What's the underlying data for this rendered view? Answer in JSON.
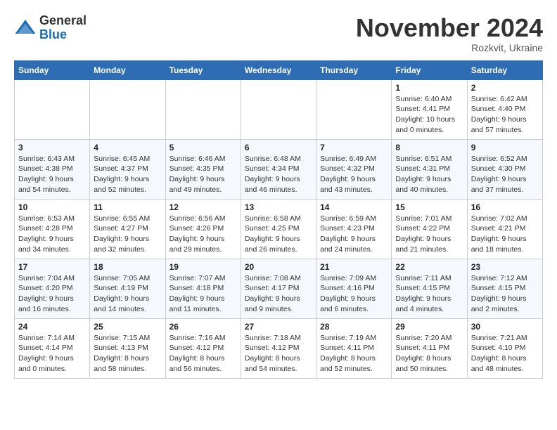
{
  "header": {
    "logo_line1": "General",
    "logo_line2": "Blue",
    "month": "November 2024",
    "location": "Rozkvit, Ukraine"
  },
  "weekdays": [
    "Sunday",
    "Monday",
    "Tuesday",
    "Wednesday",
    "Thursday",
    "Friday",
    "Saturday"
  ],
  "weeks": [
    [
      {
        "day": "",
        "info": ""
      },
      {
        "day": "",
        "info": ""
      },
      {
        "day": "",
        "info": ""
      },
      {
        "day": "",
        "info": ""
      },
      {
        "day": "",
        "info": ""
      },
      {
        "day": "1",
        "info": "Sunrise: 6:40 AM\nSunset: 4:41 PM\nDaylight: 10 hours\nand 0 minutes."
      },
      {
        "day": "2",
        "info": "Sunrise: 6:42 AM\nSunset: 4:40 PM\nDaylight: 9 hours\nand 57 minutes."
      }
    ],
    [
      {
        "day": "3",
        "info": "Sunrise: 6:43 AM\nSunset: 4:38 PM\nDaylight: 9 hours\nand 54 minutes."
      },
      {
        "day": "4",
        "info": "Sunrise: 6:45 AM\nSunset: 4:37 PM\nDaylight: 9 hours\nand 52 minutes."
      },
      {
        "day": "5",
        "info": "Sunrise: 6:46 AM\nSunset: 4:35 PM\nDaylight: 9 hours\nand 49 minutes."
      },
      {
        "day": "6",
        "info": "Sunrise: 6:48 AM\nSunset: 4:34 PM\nDaylight: 9 hours\nand 46 minutes."
      },
      {
        "day": "7",
        "info": "Sunrise: 6:49 AM\nSunset: 4:32 PM\nDaylight: 9 hours\nand 43 minutes."
      },
      {
        "day": "8",
        "info": "Sunrise: 6:51 AM\nSunset: 4:31 PM\nDaylight: 9 hours\nand 40 minutes."
      },
      {
        "day": "9",
        "info": "Sunrise: 6:52 AM\nSunset: 4:30 PM\nDaylight: 9 hours\nand 37 minutes."
      }
    ],
    [
      {
        "day": "10",
        "info": "Sunrise: 6:53 AM\nSunset: 4:28 PM\nDaylight: 9 hours\nand 34 minutes."
      },
      {
        "day": "11",
        "info": "Sunrise: 6:55 AM\nSunset: 4:27 PM\nDaylight: 9 hours\nand 32 minutes."
      },
      {
        "day": "12",
        "info": "Sunrise: 6:56 AM\nSunset: 4:26 PM\nDaylight: 9 hours\nand 29 minutes."
      },
      {
        "day": "13",
        "info": "Sunrise: 6:58 AM\nSunset: 4:25 PM\nDaylight: 9 hours\nand 26 minutes."
      },
      {
        "day": "14",
        "info": "Sunrise: 6:59 AM\nSunset: 4:23 PM\nDaylight: 9 hours\nand 24 minutes."
      },
      {
        "day": "15",
        "info": "Sunrise: 7:01 AM\nSunset: 4:22 PM\nDaylight: 9 hours\nand 21 minutes."
      },
      {
        "day": "16",
        "info": "Sunrise: 7:02 AM\nSunset: 4:21 PM\nDaylight: 9 hours\nand 18 minutes."
      }
    ],
    [
      {
        "day": "17",
        "info": "Sunrise: 7:04 AM\nSunset: 4:20 PM\nDaylight: 9 hours\nand 16 minutes."
      },
      {
        "day": "18",
        "info": "Sunrise: 7:05 AM\nSunset: 4:19 PM\nDaylight: 9 hours\nand 14 minutes."
      },
      {
        "day": "19",
        "info": "Sunrise: 7:07 AM\nSunset: 4:18 PM\nDaylight: 9 hours\nand 11 minutes."
      },
      {
        "day": "20",
        "info": "Sunrise: 7:08 AM\nSunset: 4:17 PM\nDaylight: 9 hours\nand 9 minutes."
      },
      {
        "day": "21",
        "info": "Sunrise: 7:09 AM\nSunset: 4:16 PM\nDaylight: 9 hours\nand 6 minutes."
      },
      {
        "day": "22",
        "info": "Sunrise: 7:11 AM\nSunset: 4:15 PM\nDaylight: 9 hours\nand 4 minutes."
      },
      {
        "day": "23",
        "info": "Sunrise: 7:12 AM\nSunset: 4:15 PM\nDaylight: 9 hours\nand 2 minutes."
      }
    ],
    [
      {
        "day": "24",
        "info": "Sunrise: 7:14 AM\nSunset: 4:14 PM\nDaylight: 9 hours\nand 0 minutes."
      },
      {
        "day": "25",
        "info": "Sunrise: 7:15 AM\nSunset: 4:13 PM\nDaylight: 8 hours\nand 58 minutes."
      },
      {
        "day": "26",
        "info": "Sunrise: 7:16 AM\nSunset: 4:12 PM\nDaylight: 8 hours\nand 56 minutes."
      },
      {
        "day": "27",
        "info": "Sunrise: 7:18 AM\nSunset: 4:12 PM\nDaylight: 8 hours\nand 54 minutes."
      },
      {
        "day": "28",
        "info": "Sunrise: 7:19 AM\nSunset: 4:11 PM\nDaylight: 8 hours\nand 52 minutes."
      },
      {
        "day": "29",
        "info": "Sunrise: 7:20 AM\nSunset: 4:11 PM\nDaylight: 8 hours\nand 50 minutes."
      },
      {
        "day": "30",
        "info": "Sunrise: 7:21 AM\nSunset: 4:10 PM\nDaylight: 8 hours\nand 48 minutes."
      }
    ]
  ]
}
